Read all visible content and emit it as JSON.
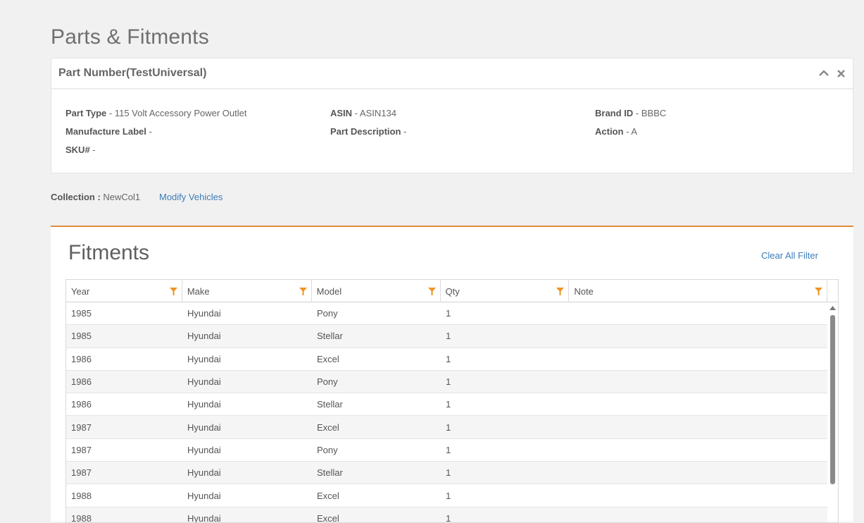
{
  "page": {
    "title": "Parts & Fitments"
  },
  "part": {
    "title": "Part Number(TestUniversal)",
    "fields": {
      "part_type_label": "Part Type",
      "part_type_value": " - 115 Volt Accessory Power Outlet",
      "asin_label": "ASIN",
      "asin_value": " - ASIN134",
      "brand_label": "Brand ID",
      "brand_value": " - BBBC",
      "manufacture_label": "Manufacture Label",
      "manufacture_value": " -",
      "description_label": "Part Description",
      "description_value": " -",
      "action_label": "Action",
      "action_value": " - A",
      "sku_label": "SKU#",
      "sku_value": " -"
    }
  },
  "collection": {
    "label": "Collection :",
    "value": " NewCol1",
    "modify_link": "Modify Vehicles"
  },
  "fitments": {
    "title": "Fitments",
    "clear_filter": "Clear All Filter",
    "columns": [
      "Year",
      "Make",
      "Model",
      "Qty",
      "Note"
    ],
    "rows": [
      [
        "1985",
        "Hyundai",
        "Pony",
        "1",
        ""
      ],
      [
        "1985",
        "Hyundai",
        "Stellar",
        "1",
        ""
      ],
      [
        "1986",
        "Hyundai",
        "Excel",
        "1",
        ""
      ],
      [
        "1986",
        "Hyundai",
        "Pony",
        "1",
        ""
      ],
      [
        "1986",
        "Hyundai",
        "Stellar",
        "1",
        ""
      ],
      [
        "1987",
        "Hyundai",
        "Excel",
        "1",
        ""
      ],
      [
        "1987",
        "Hyundai",
        "Pony",
        "1",
        ""
      ],
      [
        "1987",
        "Hyundai",
        "Stellar",
        "1",
        ""
      ],
      [
        "1988",
        "Hyundai",
        "Excel",
        "1",
        ""
      ],
      [
        "1988",
        "Hyundai",
        "Excel",
        "1",
        ""
      ]
    ]
  },
  "colors": {
    "accent": "#e08a3c",
    "link": "#3d7cb8",
    "filter_icon": "#f0931e"
  }
}
